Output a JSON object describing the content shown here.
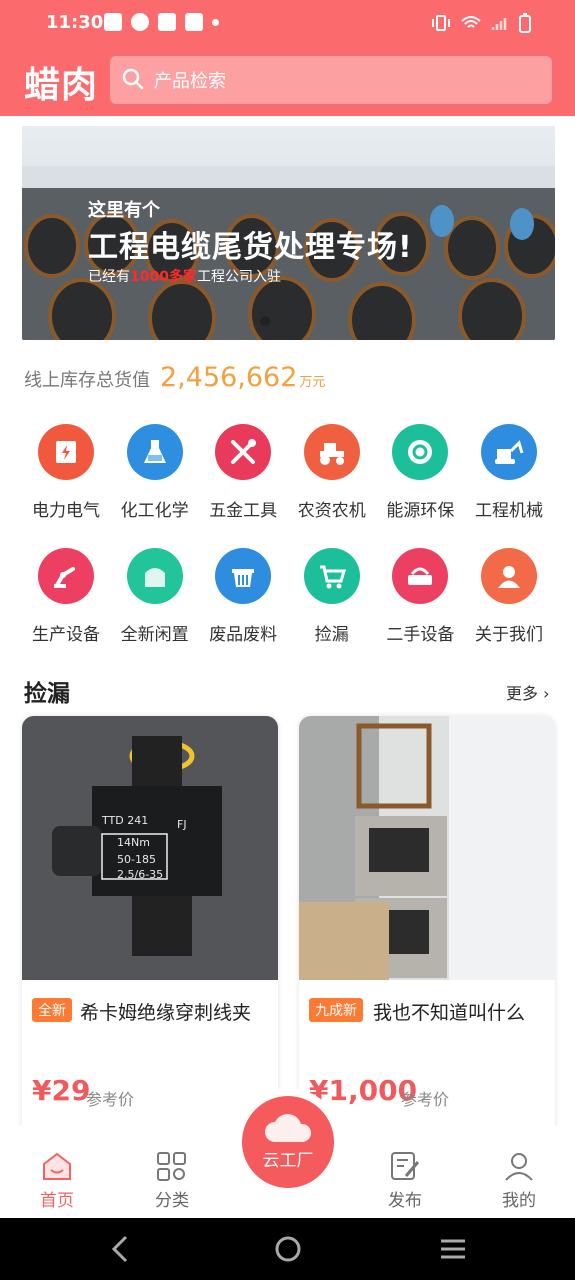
{
  "status_bar": {
    "time": "11:30"
  },
  "header": {
    "logo": "蜡肉",
    "search_placeholder": "产品检索"
  },
  "banner": {
    "line1": "这里有个",
    "line2": "工程电缆尾货处理专场!",
    "line3_prefix": "已经有",
    "line3_highlight": "1000多家",
    "line3_suffix": "工程公司入驻"
  },
  "stock": {
    "label": "线上库存总货值",
    "value": "2,456,662",
    "unit": "万元"
  },
  "categories_row1": [
    {
      "label": "电力电气",
      "icon": "power-icon",
      "color": "#f0593e"
    },
    {
      "label": "化工化学",
      "icon": "flask-icon",
      "color": "#2e8ee0"
    },
    {
      "label": "五金工具",
      "icon": "tools-icon",
      "color": "#ea3a5c"
    },
    {
      "label": "农资农机",
      "icon": "tractor-icon",
      "color": "#f06040"
    },
    {
      "label": "能源环保",
      "icon": "recycle-icon",
      "color": "#1cbf9a"
    },
    {
      "label": "工程机械",
      "icon": "excavator-icon",
      "color": "#2f8de0"
    }
  ],
  "categories_row2": [
    {
      "label": "生产设备",
      "icon": "robot-arm-icon",
      "color": "#ec3f61"
    },
    {
      "label": "全新闲置",
      "icon": "box-icon",
      "color": "#22c499"
    },
    {
      "label": "废品废料",
      "icon": "basket-icon",
      "color": "#2f8de0"
    },
    {
      "label": "捡漏",
      "icon": "cart-icon",
      "color": "#1cbf9a"
    },
    {
      "label": "二手设备",
      "icon": "device-icon",
      "color": "#ec3f61"
    },
    {
      "label": "关于我们",
      "icon": "people-icon",
      "color": "#f26a48"
    }
  ],
  "section": {
    "title": "捡漏",
    "more": "更多"
  },
  "products": [
    {
      "tag": "全新",
      "title": "希卡姆绝缘穿刺线夹",
      "price": "¥29",
      "ref": "参考价"
    },
    {
      "tag": "九成新",
      "title": "我也不知道叫什么",
      "price": "¥1,000",
      "ref": "参考价"
    }
  ],
  "tabbar": {
    "home": "首页",
    "category": "分类",
    "cloud": "云工厂",
    "publish": "发布",
    "mine": "我的"
  }
}
